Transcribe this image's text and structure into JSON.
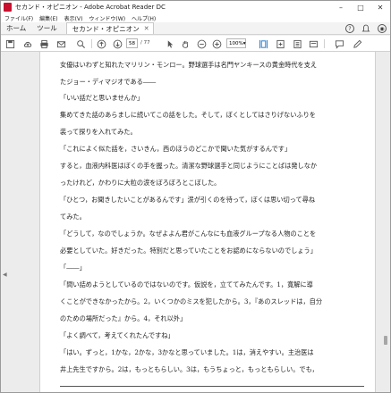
{
  "window": {
    "title": "セカンド・オピニオン - Adobe Acrobat Reader DC"
  },
  "menu": [
    "ファイル(F)",
    "編集(E)",
    "表示(V)",
    "ウィンドウ(W)",
    "ヘルプ(H)"
  ],
  "tabs": {
    "home": "ホーム",
    "tools": "ツール",
    "document": "セカンド・オピニオン"
  },
  "toolbar": {
    "page_current": "58",
    "page_total": "/ 77",
    "zoom": "100%"
  },
  "document": {
    "lines": [
      "女優はいわずと知れたマリリン・モンロー。野球選手は名門ヤンキースの黄金時代を支え",
      "たジョー・ディマジオである――",
      "「いい話だと思いませんか」",
      "集めてきた話のあらましに続いてこの話をした。そして，ぼくとしてはさりげないふりを",
      "装って探りを入れてみた。",
      "「これによく似た話を，さいきん，西のほうのどこかで聞いた気がするんです」",
      "すると，血液内科医はぼくの手を握った。清潔な野球選手と同じようにことばは発しなか",
      "ったけれど，かわりに大粒の涙をぼろぼろとこぼした。",
      "「ひとつ，お聞きしたいことがあるんです」涙が引くのを待って，ぼくは思い切って尋ね",
      "てみた。",
      "「どうして，なのでしょうか。なぜよよん君がこんなにも血液グループなる人物のことを",
      "必要としていた。好きだった。特別だと思っていたことをお認めにならないのでしょう」",
      "「――」",
      "「間い詰めようとしているのではないのです。仮説を，立ててみたんです。1，寛解に導",
      "くことができなかったから。2，いくつかのミスを犯したから。3，『あのスレッドは，自分",
      "のための場所だった』から。4，それ以外」",
      "「よく調べて，考えてくれたんですね」",
      "「はい。ずっと，1かな，2かな，3かなと思っていました。1は，消えやすい。主治医は",
      "井上先生ですから。2は，もっともらしい。3は，もうちょっと，もっともらしい。でも，"
    ]
  },
  "colors": {
    "app_icon": "#c8102e",
    "page": "#ffffff",
    "viewer_bg": "#ececec"
  }
}
